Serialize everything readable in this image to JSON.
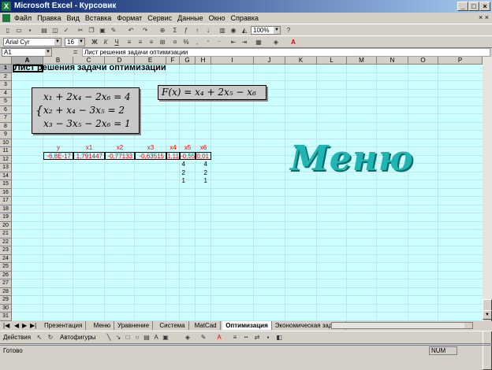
{
  "window": {
    "title": "Microsoft Excel - Курсовик"
  },
  "menu": {
    "items": [
      "Файл",
      "Правка",
      "Вид",
      "Вставка",
      "Формат",
      "Сервис",
      "Данные",
      "Окно",
      "Справка"
    ],
    "right_close": "× ×"
  },
  "toolbar": {
    "zoom": "100%",
    "font_name": "Arial Cyr",
    "font_size": "16"
  },
  "formula_bar": {
    "cell_ref": "A1",
    "equals": "=",
    "content": "Лист решения задачи оптимизации"
  },
  "columns": [
    "A",
    "B",
    "C",
    "D",
    "E",
    "F",
    "G",
    "H",
    "I",
    "J",
    "K",
    "L",
    "M",
    "N",
    "O",
    "P"
  ],
  "rows": [
    "1",
    "2",
    "3",
    "4",
    "5",
    "6",
    "7",
    "8",
    "9",
    "10",
    "11",
    "12",
    "13",
    "14",
    "15",
    "16",
    "17",
    "18",
    "19",
    "20",
    "21",
    "22",
    "23",
    "24",
    "25",
    "26",
    "27",
    "28",
    "29",
    "30",
    "31"
  ],
  "sheet": {
    "title": "Лист решения задачи оптимизации",
    "system_equations": [
      "x₁ + 2x₄ − 2x₆ = 4",
      "x₂ + x₄ − 3x₅ = 2",
      "x₃ − 3x₅ − 2x₆ = 1"
    ],
    "objective": "F(x) = x₄ + 2x₅ − x₆",
    "headers": [
      "y",
      "x1",
      "x2",
      "x3",
      "x4",
      "x5",
      "x6"
    ],
    "values": [
      "-6,8E-17",
      "1,791447",
      "-0,77133",
      "-0,63515",
      "1,11",
      "-0,55",
      "0,01"
    ],
    "constraints": [
      [
        "4",
        "4"
      ],
      [
        "2",
        "2"
      ],
      [
        "1",
        "1"
      ]
    ],
    "menu_art": "Меню"
  },
  "tabs": [
    "Презентация",
    "Меню",
    "Уравнение",
    "Система",
    "MatCad",
    "Оптимизация",
    "Экономическая задача"
  ],
  "active_tab": "Оптимизация",
  "drawing": {
    "actions": "Действия",
    "autoshapes": "Автофигуры"
  },
  "status": {
    "ready": "Готово",
    "num": "NUM"
  }
}
